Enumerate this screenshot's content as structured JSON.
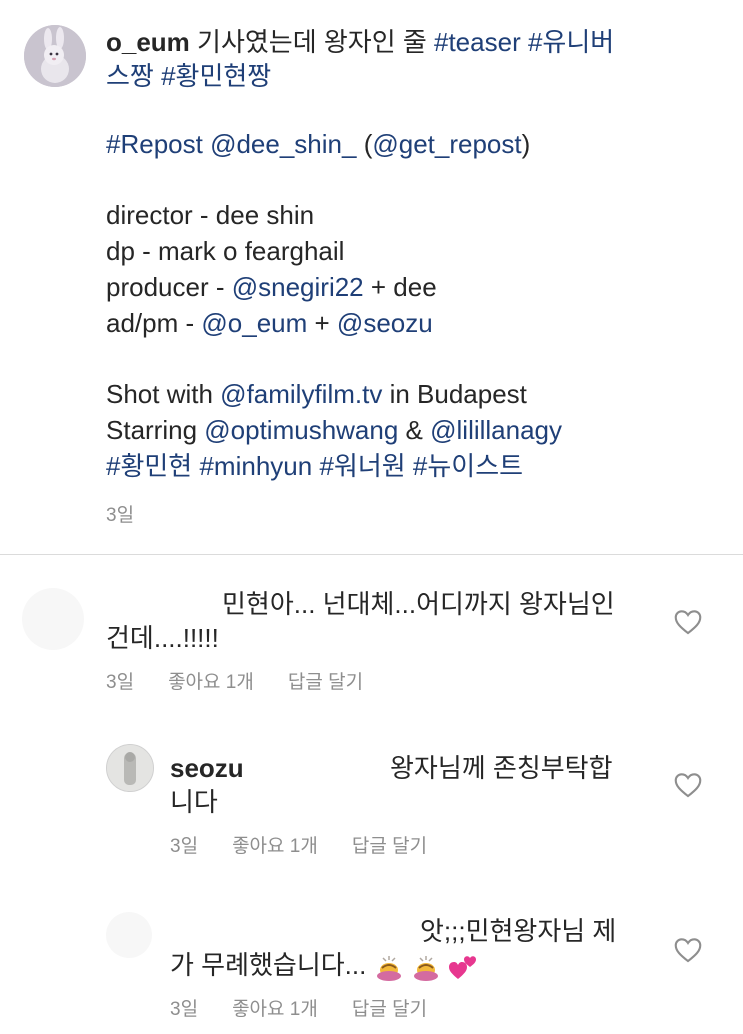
{
  "post": {
    "username": "o_eum",
    "caption_line1_text": " 기사였는데 왕자인 줄 ",
    "tag_teaser": "#teaser",
    "tag_universe_a": "#유니버",
    "tag_universe_b": "스짱",
    "tag_hwang": "#황민현짱",
    "repost_tag": "#Repost",
    "repost_user": "@dee_shin_",
    "repost_open": " (",
    "repost_via": "@get_repost",
    "repost_close": ")",
    "credit_director": "director - dee shin",
    "credit_dp": "dp - mark o fearghail",
    "credit_producer_prefix": "producer - ",
    "credit_producer_user": "@snegiri22",
    "credit_producer_suffix": " + dee",
    "credit_ad_prefix": "ad/pm - ",
    "credit_ad_user1": "@o_eum",
    "credit_ad_plus": " + ",
    "credit_ad_user2": "@seozu",
    "shot_prefix": "Shot with ",
    "shot_user": "@familyfilm.tv",
    "shot_suffix": " in Budapest",
    "starring_prefix": "Starring ",
    "starring_user1": "@optimushwang",
    "starring_amp": " & ",
    "starring_user2": "@lilillanagy",
    "tag_hwangminhyun": "#황민현",
    "tag_minhyun": "#minhyun",
    "tag_wanna": "#워너원",
    "tag_nuest": "#뉴이스트",
    "time": "3일"
  },
  "comments": [
    {
      "line1": "민현아... 넌대체...어디까지 왕자님인",
      "line2": "건데....!!!!!",
      "time": "3일",
      "likes": "좋아요 1개",
      "reply": "답글 달기"
    },
    {
      "username": "seozu",
      "line1": "왕자님께 존칭부탁합",
      "line2": "니다",
      "time": "3일",
      "likes": "좋아요 1개",
      "reply": "답글 달기"
    },
    {
      "line1": "앗;;;민현왕자님 제",
      "line2": "가 무례했습니다...",
      "time": "3일",
      "likes": "좋아요 1개",
      "reply": "답글 달기"
    }
  ],
  "icons": {
    "heart": "heart-outline-icon",
    "emoji_bow": "person-bowing-emoji",
    "emoji_hearts": "two-hearts-emoji"
  },
  "colors": {
    "link": "#1f3f77",
    "meta": "#8e8e8e",
    "text": "#262626",
    "heart_stroke": "#8e8e8e",
    "hearts_emoji": "#e7378f"
  }
}
